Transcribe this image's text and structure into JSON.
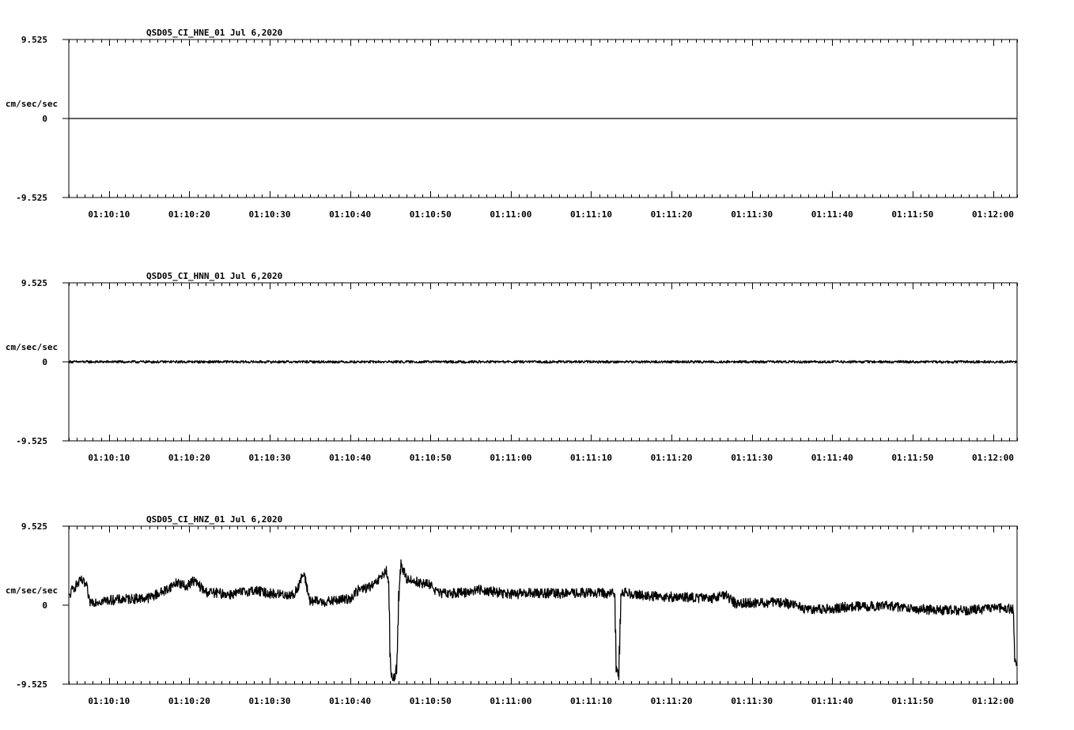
{
  "chart_data": [
    {
      "type": "line",
      "title": "QSD05_CI_HNE_01  Jul 6,2020",
      "ylabel": "cm/sec/sec",
      "ylim": [
        -9.525,
        9.525
      ],
      "y_ticks": [
        "9.525",
        "0",
        "-9.525"
      ],
      "x_range": [
        "01:10:05",
        "01:12:03"
      ],
      "x_ticks": [
        "01:10:10",
        "01:10:20",
        "01:10:30",
        "01:10:40",
        "01:10:50",
        "01:11:00",
        "01:11:10",
        "01:11:20",
        "01:11:30",
        "01:11:40",
        "01:11:50",
        "01:12:00"
      ],
      "trace": {
        "x_start": "01:10:05",
        "x_end": "01:12:03",
        "baseline": 0,
        "noise": 0,
        "points": [
          [
            "01:10:05",
            0
          ],
          [
            "01:12:03",
            0
          ]
        ]
      }
    },
    {
      "type": "line",
      "title": "QSD05_CI_HNN_01  Jul 6,2020",
      "ylabel": "cm/sec/sec",
      "ylim": [
        -9.525,
        9.525
      ],
      "y_ticks": [
        "9.525",
        "0",
        "-9.525"
      ],
      "x_range": [
        "01:10:05",
        "01:12:03"
      ],
      "x_ticks": [
        "01:10:10",
        "01:10:20",
        "01:10:30",
        "01:10:40",
        "01:10:50",
        "01:11:00",
        "01:11:10",
        "01:11:20",
        "01:11:30",
        "01:11:40",
        "01:11:50",
        "01:12:00"
      ],
      "trace": {
        "x_start": "01:10:05",
        "x_end": "01:12:03",
        "baseline": 0,
        "noise": 0.15,
        "points": [
          [
            "01:10:05",
            0
          ],
          [
            "01:12:03",
            0
          ]
        ]
      }
    },
    {
      "type": "line",
      "title": "QSD05_CI_HNZ_01  Jul 6,2020",
      "ylabel": "cm/sec/sec",
      "ylim": [
        -9.525,
        9.525
      ],
      "y_ticks": [
        "9.525",
        "0",
        "-9.525"
      ],
      "x_range": [
        "01:10:05",
        "01:12:03"
      ],
      "x_ticks": [
        "01:10:10",
        "01:10:20",
        "01:10:30",
        "01:10:40",
        "01:10:50",
        "01:11:00",
        "01:11:10",
        "01:11:20",
        "01:11:30",
        "01:11:40",
        "01:11:50",
        "01:12:00"
      ],
      "trace": {
        "x_start": "01:10:05",
        "x_end": "01:12:03",
        "noise": 0.6,
        "points": [
          [
            "01:10:05",
            1.0
          ],
          [
            "01:10:05.5",
            2.0
          ],
          [
            "01:10:06.5",
            3.0
          ],
          [
            "01:10:07.2",
            2.3
          ],
          [
            "01:10:07.5",
            0.4
          ],
          [
            "01:10:10",
            0.6
          ],
          [
            "01:10:15",
            0.9
          ],
          [
            "01:10:17",
            1.8
          ],
          [
            "01:10:18.5",
            2.8
          ],
          [
            "01:10:19.5",
            2.2
          ],
          [
            "01:10:20.5",
            3.0
          ],
          [
            "01:10:22",
            1.6
          ],
          [
            "01:10:25",
            1.3
          ],
          [
            "01:10:28",
            1.8
          ],
          [
            "01:10:30",
            1.4
          ],
          [
            "01:10:33",
            1.2
          ],
          [
            "01:10:34.2",
            3.8
          ],
          [
            "01:10:35",
            0.5
          ],
          [
            "01:10:37",
            0.4
          ],
          [
            "01:10:40",
            0.8
          ],
          [
            "01:10:41",
            1.8
          ],
          [
            "01:10:43",
            2.4
          ],
          [
            "01:10:44.5",
            4.2
          ],
          [
            "01:10:44.8",
            2.0
          ],
          [
            "01:10:45",
            -8.0
          ],
          [
            "01:10:45.3",
            -9.2
          ],
          [
            "01:10:45.8",
            -7.5
          ],
          [
            "01:10:46",
            0.5
          ],
          [
            "01:10:46.3",
            5.0
          ],
          [
            "01:10:47",
            3.2
          ],
          [
            "01:10:49",
            2.6
          ],
          [
            "01:10:50",
            2.5
          ],
          [
            "01:10:51",
            1.4
          ],
          [
            "01:10:54",
            1.5
          ],
          [
            "01:10:56",
            1.9
          ],
          [
            "01:11:00",
            1.3
          ],
          [
            "01:11:03",
            1.5
          ],
          [
            "01:11:06",
            1.4
          ],
          [
            "01:11:10",
            1.5
          ],
          [
            "01:11:12.9",
            1.4
          ],
          [
            "01:11:13.1",
            -7.5
          ],
          [
            "01:11:13.4",
            -8.6
          ],
          [
            "01:11:13.7",
            1.6
          ],
          [
            "01:11:17",
            1.1
          ],
          [
            "01:11:20",
            1.0
          ],
          [
            "01:11:25",
            0.8
          ],
          [
            "01:11:26.5",
            1.4
          ],
          [
            "01:11:28",
            0.2
          ],
          [
            "01:11:32",
            0.3
          ],
          [
            "01:11:34",
            0.3
          ],
          [
            "01:11:37",
            -0.5
          ],
          [
            "01:11:40",
            -0.4
          ],
          [
            "01:11:43",
            -0.1
          ],
          [
            "01:11:47",
            -0.1
          ],
          [
            "01:11:50",
            -0.4
          ],
          [
            "01:11:53",
            -0.6
          ],
          [
            "01:11:57",
            -0.6
          ],
          [
            "01:12:00",
            -0.4
          ],
          [
            "01:12:02.5",
            -0.4
          ],
          [
            "01:12:02.7",
            -6.5
          ],
          [
            "01:12:03",
            -7.0
          ]
        ]
      }
    }
  ]
}
